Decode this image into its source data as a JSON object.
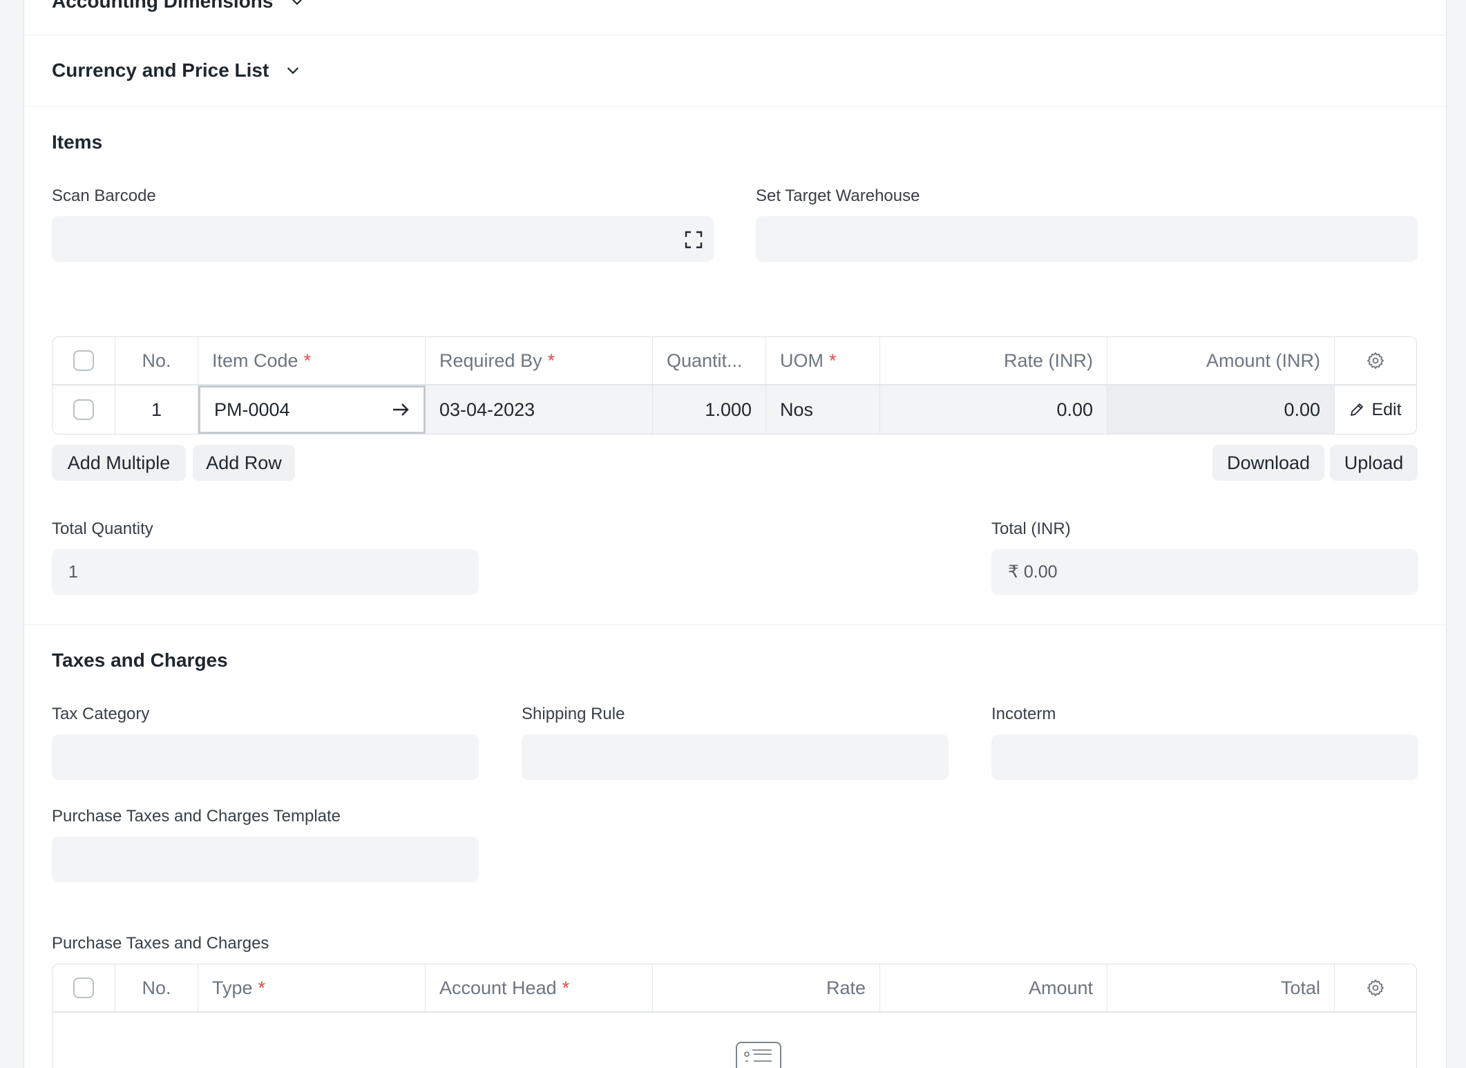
{
  "sections": {
    "accounting_dimensions": "Accounting Dimensions",
    "currency_price_list": "Currency and Price List",
    "items": "Items",
    "taxes_charges": "Taxes and Charges"
  },
  "items_section": {
    "scan_barcode_label": "Scan Barcode",
    "set_target_warehouse_label": "Set Target Warehouse",
    "grid": {
      "headers": {
        "no": "No.",
        "item_code": "Item Code",
        "required_by": "Required By",
        "quantity": "Quantit...",
        "uom": "UOM",
        "rate": "Rate (INR)",
        "amount": "Amount (INR)"
      },
      "rows": [
        {
          "no": "1",
          "item_code": "PM-0004",
          "required_by": "03-04-2023",
          "quantity": "1.000",
          "uom": "Nos",
          "rate": "0.00",
          "amount": "0.00",
          "edit": "Edit"
        }
      ]
    },
    "buttons": {
      "add_multiple": "Add Multiple",
      "add_row": "Add Row",
      "download": "Download",
      "upload": "Upload"
    },
    "total_quantity_label": "Total Quantity",
    "total_quantity_value": "1",
    "total_inr_label": "Total (INR)",
    "total_inr_value": "₹ 0.00"
  },
  "taxes_section": {
    "tax_category_label": "Tax Category",
    "shipping_rule_label": "Shipping Rule",
    "incoterm_label": "Incoterm",
    "template_label": "Purchase Taxes and Charges Template",
    "table_label": "Purchase Taxes and Charges",
    "grid": {
      "headers": {
        "no": "No.",
        "type": "Type",
        "account_head": "Account Head",
        "rate": "Rate",
        "amount": "Amount",
        "total": "Total"
      }
    }
  },
  "required_marker": "*",
  "icons": {
    "chevron": "chevron-down-icon",
    "scan": "scan-icon",
    "settings": "gear-icon",
    "arrow": "arrow-right-icon",
    "edit": "pencil-icon",
    "empty": "empty-list-icon"
  },
  "colors": {
    "required": "#e24c4c",
    "field_bg": "#f3f4f6"
  }
}
